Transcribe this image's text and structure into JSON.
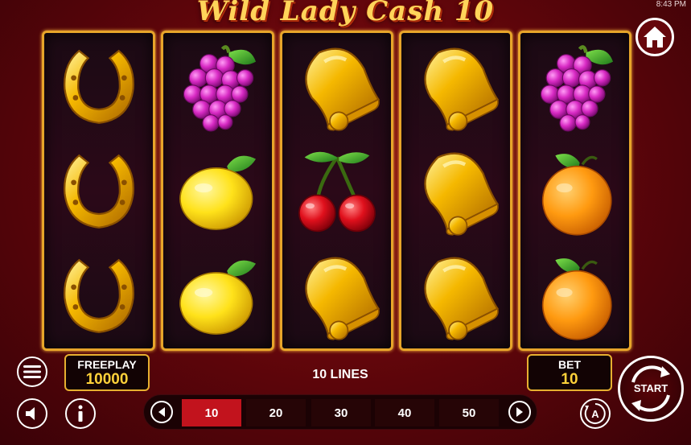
{
  "status": {
    "time": "8:43 PM"
  },
  "game": {
    "title": "Wild Lady Cash 10"
  },
  "reels": [
    [
      "horseshoe",
      "horseshoe",
      "horseshoe"
    ],
    [
      "grapes",
      "lemon",
      "lemon"
    ],
    [
      "bell",
      "cherries",
      "bell"
    ],
    [
      "bell",
      "bell",
      "bell"
    ],
    [
      "grapes",
      "orange",
      "orange"
    ]
  ],
  "freeplay": {
    "label": "FREEPLAY",
    "value": "10000"
  },
  "bet": {
    "label": "BET",
    "value": "10"
  },
  "lines": {
    "label": "10 LINES",
    "options": [
      "10",
      "20",
      "30",
      "40",
      "50"
    ],
    "selected": "10"
  },
  "start": {
    "label": "START"
  },
  "icons": {
    "home": "home-icon",
    "menu": "menu-icon",
    "sound": "speaker-icon",
    "info": "info-icon",
    "autoplay": "autoplay-icon",
    "prev": "chevron-left-icon",
    "next": "chevron-right-icon"
  },
  "colors": {
    "background": "#6a070c",
    "reel_frame": "#e7a52a",
    "value_text": "#ffd13a",
    "active_line": "#c2131d"
  }
}
